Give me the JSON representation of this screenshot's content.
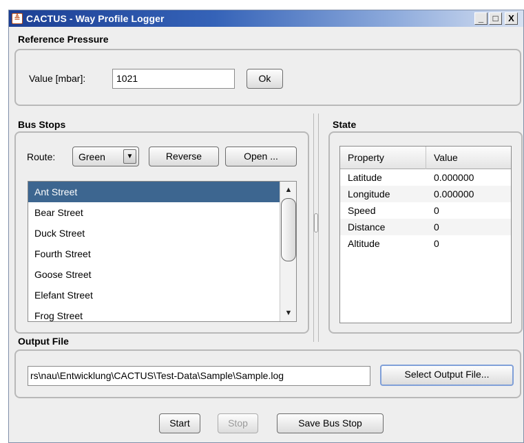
{
  "window": {
    "title": "CACTUS - Way Profile Logger",
    "app_icon_glyph": "≜",
    "controls": {
      "minimize": "_",
      "maximize": "□",
      "close": "X"
    }
  },
  "reference_pressure": {
    "title": "Reference Pressure",
    "value_label": "Value [mbar]:",
    "value": "1021",
    "ok_button": "Ok"
  },
  "bus_stops": {
    "title": "Bus Stops",
    "route_label": "Route:",
    "route_value": "Green",
    "route_arrow": "▼",
    "reverse_button": "Reverse",
    "open_button": "Open ...",
    "items": [
      {
        "label": "Ant Street",
        "selected": true
      },
      {
        "label": "Bear Street"
      },
      {
        "label": "Duck Street"
      },
      {
        "label": "Fourth Street"
      },
      {
        "label": "Goose Street"
      },
      {
        "label": "Elefant Street"
      },
      {
        "label": "Frog Street"
      }
    ],
    "scroll_up": "▲",
    "scroll_down": "▼"
  },
  "state": {
    "title": "State",
    "columns": [
      "Property",
      "Value"
    ],
    "rows": [
      {
        "property": "Latitude",
        "value": "0.000000"
      },
      {
        "property": "Longitude",
        "value": "0.000000"
      },
      {
        "property": "Speed",
        "value": "0"
      },
      {
        "property": "Distance",
        "value": "0"
      },
      {
        "property": "Altitude",
        "value": "0"
      }
    ]
  },
  "output_file": {
    "title": "Output File",
    "path": "rs\\nau\\Entwicklung\\CACTUS\\Test-Data\\Sample\\Sample.log",
    "select_button": "Select Output File..."
  },
  "actions": {
    "start_button": "Start",
    "stop_button": "Stop",
    "save_bus_stop_button": "Save Bus Stop"
  },
  "colors": {
    "selection": "#3d6690",
    "titlebar": "#1c3f94",
    "window_bg": "#eeeeee"
  }
}
